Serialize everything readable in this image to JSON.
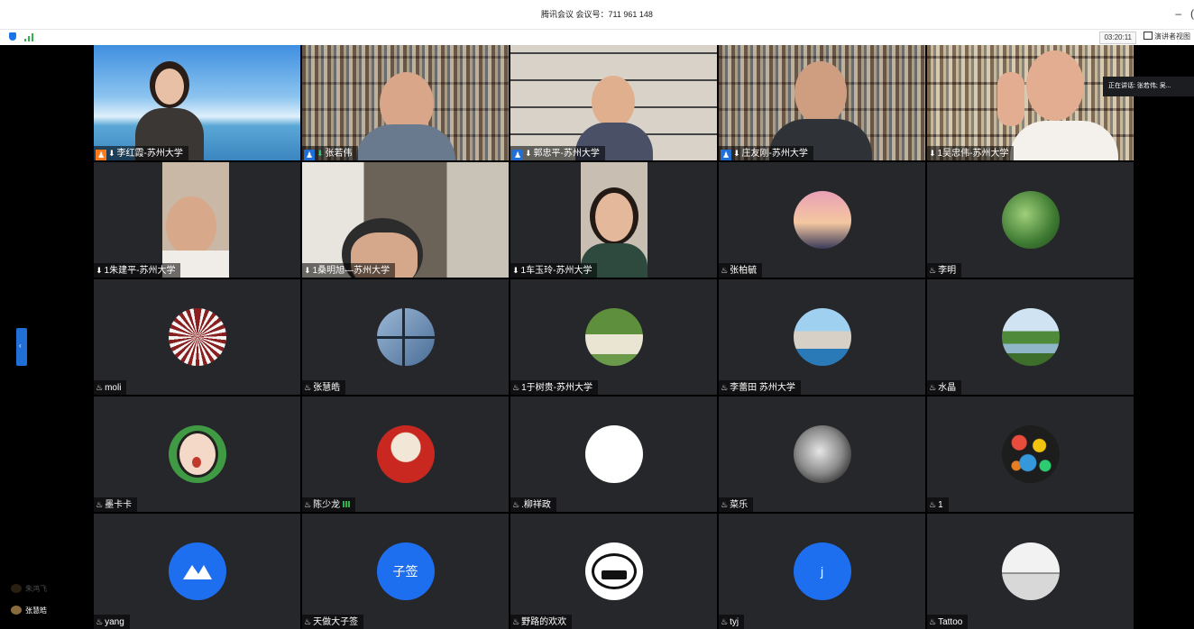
{
  "window": {
    "title": "腾讯会议 会议号：711 961 148",
    "minimize": "–",
    "extra": "("
  },
  "toolbar": {
    "timer": "03:20:11",
    "speaker_view": "演讲者视图"
  },
  "tooltip": "正在讲话: 张若伟; 吴...",
  "side_tab_icon": "‹",
  "participants_mini": [
    {
      "name": "朱鸿飞"
    },
    {
      "name": "张慧皓"
    }
  ],
  "tiles": [
    {
      "name": "李红霞-苏州大学",
      "host": true,
      "mic": "⬇"
    },
    {
      "name": "张若伟",
      "host": true,
      "mic": "⬇"
    },
    {
      "name": "郭忠平-苏州大学",
      "host": true,
      "mic": "⬇"
    },
    {
      "name": "庄友刚-苏州大学",
      "host": true,
      "mic": "⬇"
    },
    {
      "name": "1吴忠伟-苏州大学",
      "host": false,
      "mic": "⬇"
    },
    {
      "name": "1朱建平-苏州大学",
      "mic": "⬇"
    },
    {
      "name": "1桑明旭—苏州大学",
      "mic": "⬇"
    },
    {
      "name": "1车玉玲-苏州大学",
      "mic": "⬇"
    },
    {
      "name": "张柏毓",
      "mic": "♨"
    },
    {
      "name": "李明",
      "mic": "♨"
    },
    {
      "name": "moli",
      "mic": "♨"
    },
    {
      "name": "张慧皓",
      "mic": "♨"
    },
    {
      "name": "1于树贵-苏州大学",
      "mic": "♨"
    },
    {
      "name": "李蕾田 苏州大学",
      "mic": "♨"
    },
    {
      "name": "水晶",
      "mic": "♨"
    },
    {
      "name": "墨卡卡",
      "mic": "♨"
    },
    {
      "name": "陈少龙",
      "mic": "♨",
      "signal": true
    },
    {
      "name": ".柳祥政",
      "mic": "♨"
    },
    {
      "name": "菜乐",
      "mic": "♨"
    },
    {
      "name": "1",
      "mic": "♨"
    },
    {
      "name": "yang",
      "mic": "♨"
    },
    {
      "name": "天做大子签",
      "mic": "♨",
      "avatar_text": "子签"
    },
    {
      "name": "野路的欢欢",
      "mic": "♨"
    },
    {
      "name": "tyj",
      "mic": "♨",
      "avatar_text": "j"
    },
    {
      "name": "Tattoo",
      "mic": "♨"
    }
  ],
  "colors": {
    "accent": "#1f6fd6",
    "active_speaker": "#2ecc71",
    "tile_bg": "#26272b",
    "avatar_blue": "#1e6ff0"
  }
}
